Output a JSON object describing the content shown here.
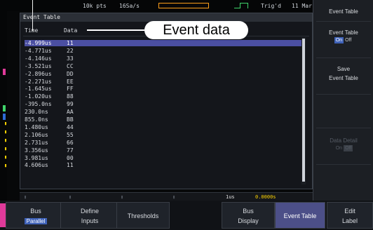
{
  "status": {
    "points": "10k pts",
    "sample_rate": "16Sa/s",
    "trigger_state": "Trig'd",
    "date": "11 Mar"
  },
  "event_table": {
    "title": "Event Table",
    "col_time": "Time",
    "col_data": "Data",
    "rows": [
      {
        "time": "-4.999us",
        "data": "11"
      },
      {
        "time": "-4.771us",
        "data": "22"
      },
      {
        "time": "-4.146us",
        "data": "33"
      },
      {
        "time": "-3.521us",
        "data": "CC"
      },
      {
        "time": "-2.896us",
        "data": "DD"
      },
      {
        "time": "-2.271us",
        "data": "EE"
      },
      {
        "time": "-1.645us",
        "data": "FF"
      },
      {
        "time": "-1.020us",
        "data": "88"
      },
      {
        "time": "-395.0ns",
        "data": "99"
      },
      {
        "time": "230.0ns",
        "data": "AA"
      },
      {
        "time": "855.0ns",
        "data": "BB"
      },
      {
        "time": "1.480us",
        "data": "44"
      },
      {
        "time": "2.106us",
        "data": "55"
      },
      {
        "time": "2.731us",
        "data": "66"
      },
      {
        "time": "3.356us",
        "data": "77"
      },
      {
        "time": "3.981us",
        "data": "00"
      },
      {
        "time": "4.606us",
        "data": "11"
      }
    ]
  },
  "callout": {
    "label": "Event data"
  },
  "bottom_bar": {
    "zoom": "1us",
    "position": "0.0000s"
  },
  "side_menu": {
    "title": "Event Table",
    "event_table_label": "Event Table",
    "event_table_on": "On",
    "event_table_off": "Off",
    "save_line1": "Save",
    "save_line2": "Event Table",
    "data_detail_label": "Data Detail",
    "data_detail_on": "On",
    "data_detail_off": "Off"
  },
  "softkeys": {
    "bus_label": "Bus",
    "bus_value": "Parallel",
    "define_inputs_1": "Define",
    "define_inputs_2": "Inputs",
    "thresholds": "Thresholds",
    "bus_display_1": "Bus",
    "bus_display_2": "Display",
    "event_table": "Event Table",
    "edit_label_1": "Edit",
    "edit_label_2": "Label"
  },
  "colors": {
    "selected_row": "#4b4fa2",
    "accent_blue": "#3f62b8",
    "trigger_green": "#3fd36a",
    "digital_yellow": "#ffd400",
    "ch_pink": "#e03a9a"
  }
}
